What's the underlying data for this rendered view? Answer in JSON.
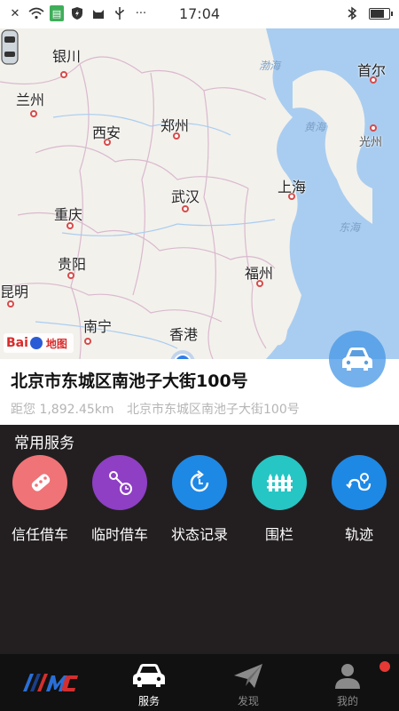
{
  "status_bar": {
    "time": "17:04",
    "left_icons": [
      "close-icon",
      "wifi-icon",
      "sim-icon",
      "shield-icon",
      "cat-icon",
      "usb-icon",
      "more-dots-icon"
    ],
    "right_icons": [
      "bluetooth-icon",
      "battery-icon"
    ],
    "battery_level": 0.86
  },
  "map": {
    "cities": [
      {
        "name": "银川"
      },
      {
        "name": "兰州"
      },
      {
        "name": "西安"
      },
      {
        "name": "郑州"
      },
      {
        "name": "武汉"
      },
      {
        "name": "上海"
      },
      {
        "name": "重庆"
      },
      {
        "name": "贵阳"
      },
      {
        "name": "昆明"
      },
      {
        "name": "南宁"
      },
      {
        "name": "香港"
      },
      {
        "name": "福州"
      },
      {
        "name": "首尔"
      },
      {
        "name": "光州"
      }
    ],
    "seas": [
      "渤海",
      "黄海",
      "东海"
    ],
    "provider_logo_text": "Bai",
    "provider_logo_text_2": "地图"
  },
  "address": {
    "title": "北京市东城区南池子大街100号",
    "distance": "距您 1,892.45km",
    "subtitle": "北京市东城区南池子大街100号"
  },
  "services": {
    "title": "常用服务",
    "items": [
      {
        "label": "信任借车",
        "icon": "car-key-icon",
        "color": "#f07377"
      },
      {
        "label": "临时借车",
        "icon": "timed-key-icon",
        "color": "#8e3fc4"
      },
      {
        "label": "状态记录",
        "icon": "history-refresh-icon",
        "color": "#1e88e5"
      },
      {
        "label": "围栏",
        "icon": "fence-icon",
        "color": "#26c6c4"
      },
      {
        "label": "轨迹",
        "icon": "route-icon",
        "color": "#1e88e5"
      }
    ]
  },
  "tabbar": {
    "tabs": [
      {
        "label": "",
        "icon": "brand-logo-icon"
      },
      {
        "label": "服务",
        "icon": "car-icon",
        "active": true
      },
      {
        "label": "发现",
        "icon": "paper-plane-icon"
      },
      {
        "label": "我的",
        "icon": "user-icon",
        "badge": true
      }
    ]
  }
}
